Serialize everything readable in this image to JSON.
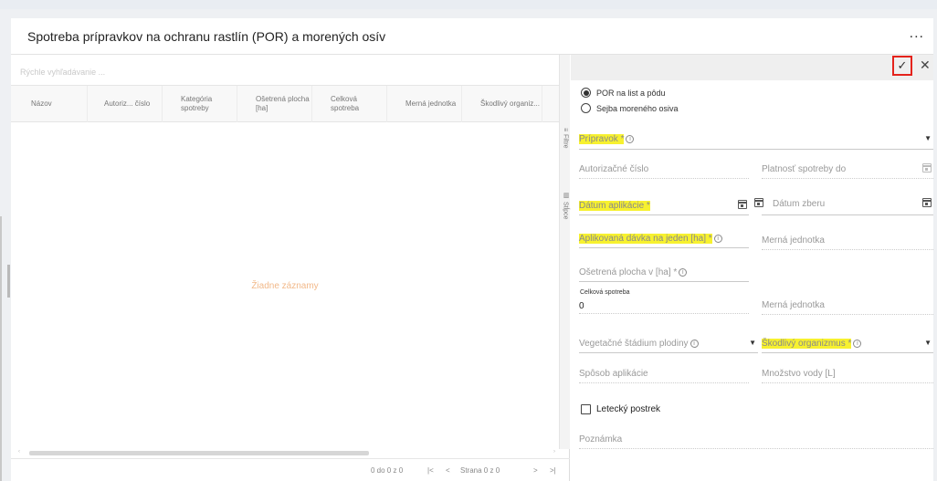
{
  "page": {
    "title": "Spotreba prípravkov na ochranu rastlín (POR) a morených osív",
    "more_label": "..."
  },
  "grid": {
    "search_placeholder": "Rýchle vyhľadávanie ...",
    "columns": [
      {
        "label": "Názov"
      },
      {
        "label": "Autoriz... číslo"
      },
      {
        "label": "Kategória spotreby"
      },
      {
        "label": "Ošetrená plocha [ha]"
      },
      {
        "label": "Celková spotreba"
      },
      {
        "label": "Merná jednotka"
      },
      {
        "label": "Škodlivý organiz..."
      }
    ],
    "empty_text": "Žiadne záznamy",
    "side_filter": "Filtre",
    "side_columns": "Stĺpce",
    "pager": {
      "range": "0 do 0 z 0",
      "first": "|<",
      "prev": "<",
      "page": "Strana 0 z 0",
      "next": ">",
      "last": ">|"
    }
  },
  "form": {
    "confirm_icon": "checkmark-icon",
    "close_icon": "close-icon",
    "radios": [
      {
        "label": "POR na list a pôdu",
        "selected": true
      },
      {
        "label": "Sejba moreného osiva",
        "selected": false
      }
    ],
    "pripravok": "Prípravok *",
    "autorizacne_cislo": "Autorizačné číslo",
    "platnost_spotreby": "Platnosť spotreby do",
    "datum_aplikacie": "Dátum aplikácie *",
    "datum_zberu": "Dátum zberu",
    "aplikovana_davka": "Aplikovaná dávka na jeden [ha] *",
    "merna_jednotka_1": "Merná jednotka",
    "osetrena_plocha": "Ošetrená plocha v [ha] *",
    "celkova_spotreba_label": "Celková spotreba",
    "celkova_spotreba_value": "0",
    "merna_jednotka_2": "Merná jednotka",
    "vegetacne_stadium": "Vegetačné štádium plodiny",
    "skodlivy_organizmus": "Škodlivý organizmus *",
    "sposob_aplikacie": "Spôsob aplikácie",
    "mnozstvo_vody": "Množstvo vody [L]",
    "letecky_postrek": "Letecký postrek",
    "poznamka": "Poznámka",
    "highlight_color": "#f7f12f",
    "confirm_border_color": "#e4231c"
  }
}
